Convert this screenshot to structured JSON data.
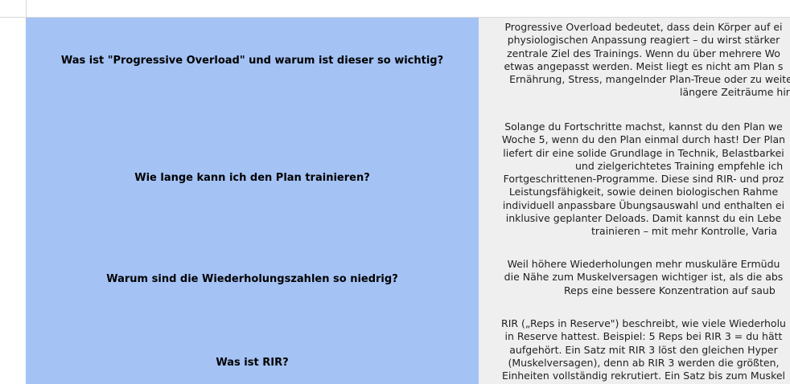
{
  "faq": [
    {
      "question": "Was ist \"Progressive Overload\" und warum ist dieser so wichtig?",
      "answer_lines": [
        "Progressive Overload bedeutet, dass dein Körper auf ei",
        "physiologischen Anpassung reagiert – du wirst stärker",
        "zentrale Ziel des Trainings. Wenn du über mehrere Wo",
        "etwas angepasst werden. Meist liegt es nicht am Plan s",
        "Ernährung, Stress, mangelnder Plan-Treue oder zu weite",
        "längere Zeiträume hir"
      ]
    },
    {
      "question": "Wie lange kann ich den Plan trainieren?",
      "answer_lines": [
        "Solange du Fortschritte machst, kannst du den Plan we",
        "Woche 5, wenn du den Plan einmal durch hast! Der Plan",
        "liefert dir eine solide Grundlage in Technik, Belastbarkei",
        "und zielgerichtetes Training empfehle ich",
        "Fortgeschrittenen-Programme. Diese sind RIR- und proz",
        "Leistungsfähigkeit, sowie deinen biologischen Rahme",
        "individuell anpassbare Übungsauswahl und enthalten ei",
        "inklusive geplanter Deloads. Damit kannst du ein Lebe",
        "trainieren – mit mehr Kontrolle, Varia"
      ]
    },
    {
      "question": "Warum sind die Wiederholungszahlen so niedrig?",
      "answer_lines": [
        "Weil höhere Wiederholungen mehr muskuläre Ermüdu",
        "die Nähe zum Muskelversagen wichtiger ist, als die abs",
        "Reps eine bessere Konzentration auf saub"
      ]
    },
    {
      "question": "Was ist RIR?",
      "answer_lines": [
        "RIR („Reps in Reserve\") beschreibt, wie viele Wiederholu",
        "in Reserve hattest. Beispiel: 5 Reps bei RIR 3 = du hätt",
        "aufgehört.  Ein Satz mit RIR 3 löst den gleichen Hyper",
        "(Muskelversagen), denn ab RIR 3 werden die größten,",
        "Einheiten vollständig rekrutiert. Ein Satz bis zum Muskel"
      ]
    }
  ]
}
